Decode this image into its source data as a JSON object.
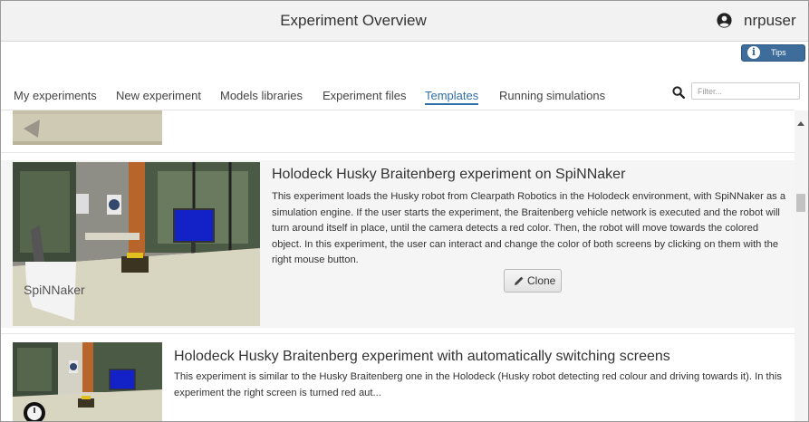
{
  "header": {
    "title": "Experiment Overview",
    "username": "nrpuser"
  },
  "tips": {
    "label": "Tips"
  },
  "tabs": [
    {
      "label": "My experiments",
      "active": false
    },
    {
      "label": "New experiment",
      "active": false
    },
    {
      "label": "Models libraries",
      "active": false
    },
    {
      "label": "Experiment files",
      "active": false
    },
    {
      "label": "Templates",
      "active": true
    },
    {
      "label": "Running simulations",
      "active": false
    }
  ],
  "filter": {
    "placeholder": "Filter...",
    "value": ""
  },
  "experiments": [
    {
      "title": "Holodeck Husky Braitenberg experiment on SpiNNaker",
      "description": "This experiment loads the Husky robot from Clearpath Robotics in the Holodeck environment, with SpiNNaker as a simulation engine. If the user starts the experiment, the Braitenberg vehicle network is executed and the robot will turn around itself in place, until the camera detects a red color. Then, the robot will move towards the colored object. In this experiment, the user can interact and change the color of both screens by clicking on them with the right mouse button.",
      "thumbnail_text": "SpiNNaker",
      "clone_label": "Clone"
    },
    {
      "title": "Holodeck Husky Braitenberg experiment with automatically switching screens",
      "description": "This experiment is similar to the Husky Braitenberg one in the Holodeck (Husky robot detecting red colour and driving towards it). In this experiment the right screen is turned red aut..."
    }
  ],
  "colors": {
    "accent": "#2e6fa7",
    "tips_button": "#3e6d9c",
    "header_bg": "#f2f2f2",
    "selected_card_bg": "#f5f5f5"
  }
}
